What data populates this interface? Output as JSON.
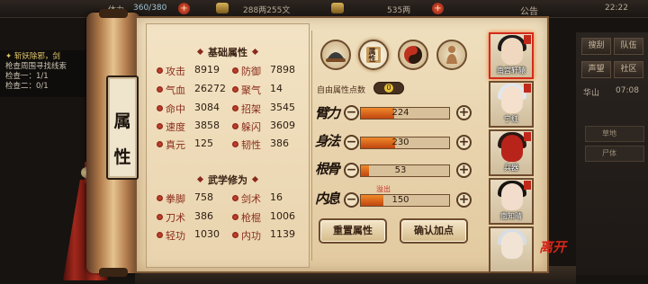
{
  "hud": {
    "stamina_label": "体力",
    "stamina": "360/380",
    "silver": "288两255文",
    "gold": "535两",
    "notice": "公告",
    "clock": "22:22"
  },
  "quest": {
    "title": "✦ 斩妖除邪，剑",
    "desc": "枪查周围寻找线索",
    "step1": "检查一：1/1",
    "step2": "检查二：0/1"
  },
  "side_menu": {
    "btn1": "搜刮",
    "btn2": "队伍",
    "btn3": "声望",
    "btn4": "社区",
    "location": "华山",
    "time": "07:08",
    "item1": "草地",
    "item2": "尸体"
  },
  "panel": {
    "vertical_title": [
      "属",
      "性"
    ],
    "base_title": "基础属性",
    "martial_title": "武学修为"
  },
  "base_stats": [
    {
      "label": "攻击",
      "value": "8919"
    },
    {
      "label": "防御",
      "value": "7898"
    },
    {
      "label": "气血",
      "value": "26272"
    },
    {
      "label": "聚气",
      "value": "14"
    },
    {
      "label": "命中",
      "value": "3084"
    },
    {
      "label": "招架",
      "value": "3545"
    },
    {
      "label": "速度",
      "value": "3858"
    },
    {
      "label": "躲闪",
      "value": "3609"
    },
    {
      "label": "真元",
      "value": "125"
    },
    {
      "label": "韧性",
      "value": "386"
    }
  ],
  "martial_stats": [
    {
      "label": "拳脚",
      "value": "758"
    },
    {
      "label": "剑术",
      "value": "16"
    },
    {
      "label": "刀术",
      "value": "386"
    },
    {
      "label": "枪棍",
      "value": "1006"
    },
    {
      "label": "轻功",
      "value": "1030"
    },
    {
      "label": "内功",
      "value": "1139"
    }
  ],
  "tab_icons": [
    "hat-icon",
    "attribute-scroll-icon",
    "yinyang-icon",
    "meridian-body-icon"
  ],
  "tab_active_label": "属性",
  "free_points": {
    "label": "自由属性点数",
    "value": "0"
  },
  "attributes": [
    {
      "name": "臂力",
      "value": "224",
      "fill": 0.38
    },
    {
      "name": "身法",
      "value": "230",
      "fill": 0.39
    },
    {
      "name": "根骨",
      "value": "53",
      "fill": 0.09
    },
    {
      "name": "内息",
      "value": "150",
      "fill": 0.26
    }
  ],
  "overflow_label": "溢出",
  "buttons": {
    "reset": "重置属性",
    "confirm": "确认加点"
  },
  "characters": [
    {
      "name": "南宫轩辕"
    },
    {
      "name": "宁红"
    },
    {
      "name": "兵器"
    },
    {
      "name": "南知晴"
    },
    {
      "name": ""
    }
  ],
  "close_label": "离开",
  "colors": {
    "accent_red": "#8a2d1c",
    "bar_fill": "#e0691d",
    "paper": "#ecdcb8"
  }
}
